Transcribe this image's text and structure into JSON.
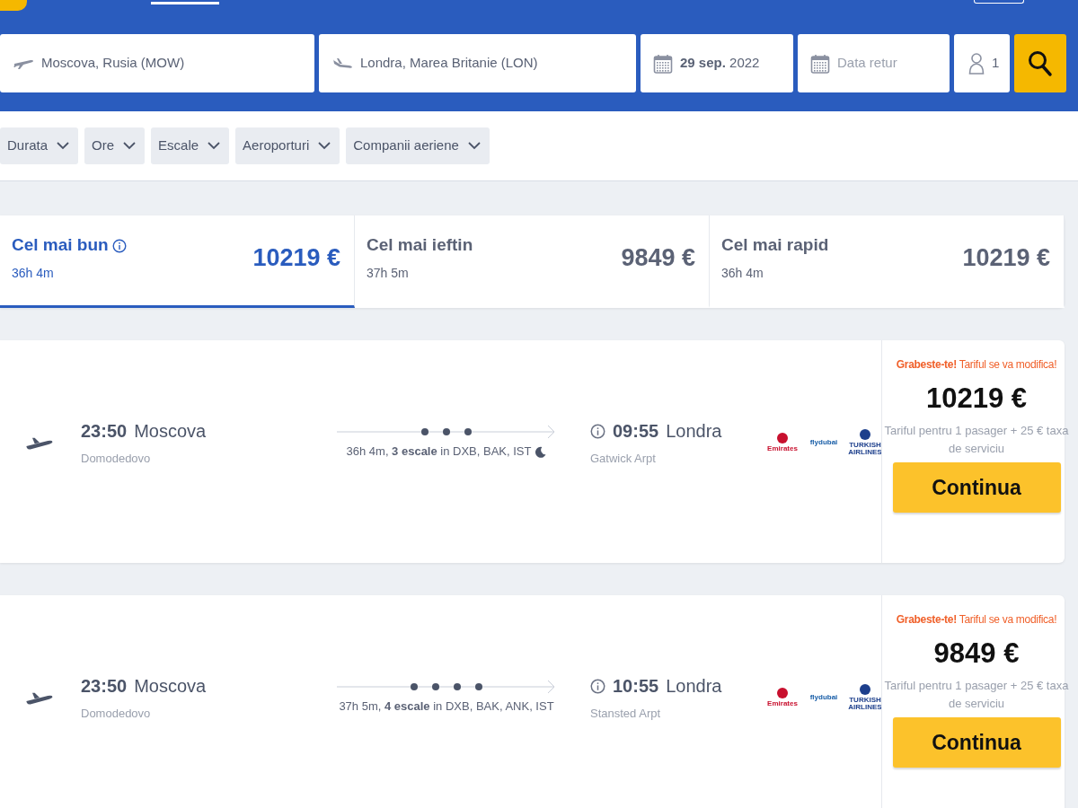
{
  "search": {
    "origin": "Moscova, Rusia (MOW)",
    "destination": "Londra, Marea Britanie (LON)",
    "depart_date": "**29 sep.** 2022",
    "return_placeholder": "Data retur",
    "passengers": "1"
  },
  "filters": [
    {
      "label": "Durata"
    },
    {
      "label": "Ore"
    },
    {
      "label": "Escale"
    },
    {
      "label": "Aeroporturi"
    },
    {
      "label": "Companii aeriene"
    }
  ],
  "sort_tabs": [
    {
      "label": "Cel mai bun",
      "duration": "36h 4m",
      "price": "10219 €",
      "info": true,
      "selected": true
    },
    {
      "label": "Cel mai ieftin",
      "duration": "37h 5m",
      "price": "9849 €",
      "info": false,
      "selected": false
    },
    {
      "label": "Cel mai rapid",
      "duration": "36h 4m",
      "price": "10219 €",
      "info": false,
      "selected": false
    }
  ],
  "results": [
    {
      "depart_time": "23:50",
      "depart_city": "Moscova",
      "depart_airport": "Domodedovo",
      "summary": "36h 4m, **3 escale** in DXB, BAK, IST",
      "night": true,
      "arrive_time": "09:55",
      "arrive_city": "Londra",
      "arrive_airport": "Gatwick Arpt",
      "airlines": [
        {
          "name": "Emirates",
          "color": "#c8102e"
        },
        {
          "name": "flydubai",
          "color": "#1a5fa8"
        },
        {
          "name": "TURKISH AIRLINES",
          "color": "#1d3f8c"
        }
      ],
      "hurry": "**Grabeste-te!** Tariful se va modifica!",
      "price": "10219 €",
      "fare_note": "Tariful pentru 1 pasager + 25 € taxa de serviciu",
      "button": "Continua"
    },
    {
      "depart_time": "23:50",
      "depart_city": "Moscova",
      "depart_airport": "Domodedovo",
      "summary": "37h 5m, **4 escale** in DXB, BAK, ANK, IST",
      "night": false,
      "arrive_time": "10:55",
      "arrive_city": "Londra",
      "arrive_airport": "Stansted Arpt",
      "airlines": [
        {
          "name": "Emirates",
          "color": "#c8102e"
        },
        {
          "name": "flydubai",
          "color": "#1a5fa8"
        },
        {
          "name": "TURKISH AIRLINES",
          "color": "#1d3f8c"
        }
      ],
      "hurry": "**Grabeste-te!** Tariful se va modifica!",
      "price": "9849 €",
      "fare_note": "Tariful pentru 1 pasager + 25 € taxa de serviciu",
      "button": "Continua"
    }
  ]
}
